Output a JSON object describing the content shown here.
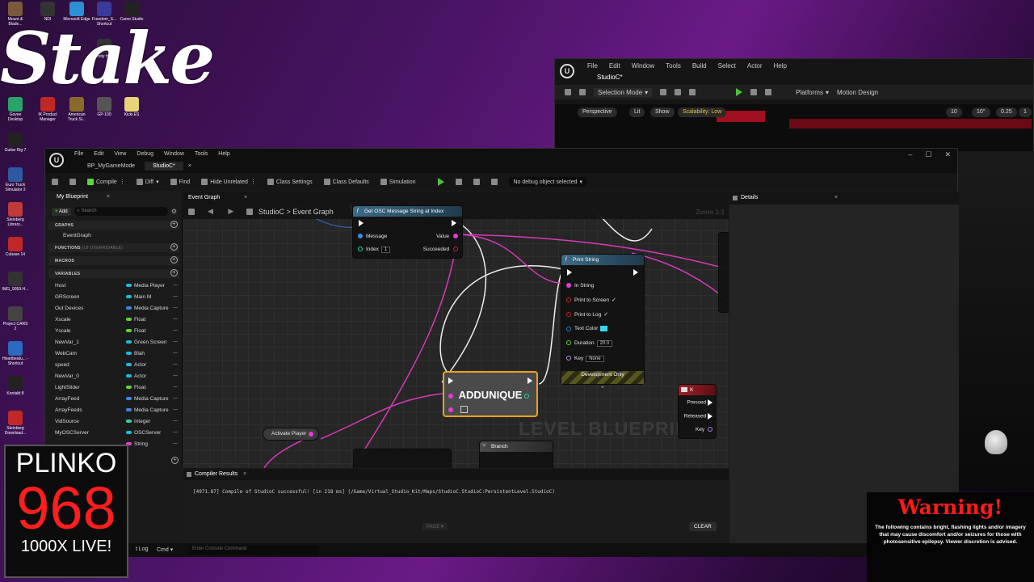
{
  "desktop": {
    "icons": [
      {
        "label": "Mount & Blade...",
        "color": "#7a5a3a"
      },
      {
        "label": "NDI",
        "color": "#333333"
      },
      {
        "label": "Microsoft Edge",
        "color": "#2d8fd6"
      },
      {
        "label": "Freedom_S... Shortcut",
        "color": "#3a3a9a"
      },
      {
        "label": "Camo Studio",
        "color": "#222222"
      },
      {
        "label": "Unity Hub",
        "color": "#333333"
      },
      {
        "label": "Govee Desktop",
        "color": "#2aa36a"
      },
      {
        "label": "IK Product Manager",
        "color": "#c02828"
      },
      {
        "label": "American Truck Si...",
        "color": "#8a6a2a"
      },
      {
        "label": "GP-100",
        "color": "#555555"
      },
      {
        "label": "Kicki.ES",
        "color": "#e8d27a"
      },
      {
        "label": "Guitar Rig 7",
        "color": "#222222"
      },
      {
        "label": "Euro Truck Simulator 2",
        "color": "#2d5aa0"
      },
      {
        "label": "Steinberg Library...",
        "color": "#c03a3a"
      },
      {
        "label": "Cubase 14",
        "color": "#c02828"
      },
      {
        "label": "IMG_9059.H...",
        "color": "#333333"
      },
      {
        "label": "Project CARS 2",
        "color": "#444444"
      },
      {
        "label": "Heartbeatu... - Shortcut",
        "color": "#2a6ac0"
      },
      {
        "label": "Kontakt 8",
        "color": "#222222"
      },
      {
        "label": "Steinberg Download...",
        "color": "#c02828"
      }
    ]
  },
  "overlays": {
    "stake_logo": "Stake",
    "plinko": {
      "title": "PLINKO",
      "number": "968",
      "subtitle": "1000X LIVE!"
    },
    "warning": {
      "title": "Warning!",
      "text": "The following contains bright, flashing lights and/or imagery that may cause discomfort and/or seizures for those with photosensitive epilepsy. Viewer discretion is advised."
    }
  },
  "back_window": {
    "menu": [
      "File",
      "Edit",
      "Window",
      "Tools",
      "Build",
      "Select",
      "Actor",
      "Help"
    ],
    "tab": "StudioC*",
    "toolbar": {
      "selection_mode": "Selection Mode",
      "platforms": "Platforms",
      "motion_design": "Motion Design"
    },
    "viewport": {
      "perspective": "Perspective",
      "lit": "Lit",
      "show": "Show",
      "scalability": "Scalability: Low",
      "grid": "10",
      "angle": "10°",
      "scale": "0.25",
      "cam": "1"
    }
  },
  "main_window": {
    "menu": [
      "File",
      "Edit",
      "View",
      "Debug",
      "Window",
      "Tools",
      "Help"
    ],
    "tabs": [
      "BP_MyGameMode",
      "StudioC*"
    ],
    "toolbar": {
      "compile": "Compile",
      "diff": "Diff",
      "find": "Find",
      "hide_unrelated": "Hide Unrelated",
      "class_settings": "Class Settings",
      "class_defaults": "Class Defaults",
      "simulation": "Simulation",
      "debug_object": "No debug object selected"
    },
    "my_blueprint": {
      "tab": "My Blueprint",
      "add": "Add",
      "search_placeholder": "Search",
      "sections": {
        "graphs": "GRAPHS",
        "event_graph": "EventGraph",
        "functions": "FUNCTIONS",
        "functions_count": "(19 OVERRIDABLE)",
        "macros": "MACROS",
        "variables": "VARIABLES"
      },
      "variables": [
        {
          "name": "Host",
          "type": "Media Player",
          "color": "#1fb8e0"
        },
        {
          "name": "GRScreen",
          "type": "Main M",
          "color": "#1fb8e0"
        },
        {
          "name": "Out Devices",
          "type": "Media Capture",
          "color": "#3a8ae0"
        },
        {
          "name": "Xscale",
          "type": "Float",
          "color": "#5fd43a"
        },
        {
          "name": "Yscale",
          "type": "Float",
          "color": "#5fd43a"
        },
        {
          "name": "NewVar_1",
          "type": "Green Screen",
          "color": "#1fb8e0"
        },
        {
          "name": "WebCam",
          "type": "Blah",
          "color": "#1fb8e0"
        },
        {
          "name": "speed",
          "type": "Actor",
          "color": "#1fb8e0"
        },
        {
          "name": "NewVar_0",
          "type": "Actor",
          "color": "#1fb8e0"
        },
        {
          "name": "LightSlider",
          "type": "Float",
          "color": "#5fd43a"
        },
        {
          "name": "ArrayFeed",
          "type": "Media Capture",
          "color": "#3a8ae0"
        },
        {
          "name": "ArrayFeeds",
          "type": "Media Capture",
          "color": "#3a8ae0"
        },
        {
          "name": "VidSource",
          "type": "Integer",
          "color": "#2ad4a8"
        },
        {
          "name": "MyOSCServer",
          "type": "OSCServer",
          "color": "#1fb8e0"
        },
        {
          "name": "",
          "type": "String",
          "color": "#e23ed0"
        }
      ]
    },
    "graph": {
      "tab": "Event Graph",
      "breadcrumb": "StudioC > Event Graph",
      "zoom": "Zoom 1:1",
      "watermark": "LEVEL BLUEPRINT",
      "nodes": {
        "get_osc": {
          "title": "Get OSC Message String at Index",
          "message": "Message",
          "index": "Index",
          "index_value": "1",
          "value": "Value",
          "succeeded": "Succeeded"
        },
        "print_string": {
          "title": "Print String",
          "in_string": "In String",
          "print_to_screen": "Print to Screen",
          "print_to_log": "Print to Log",
          "text_color": "Text Color",
          "duration": "Duration",
          "duration_value": "20.0",
          "key": "Key",
          "key_value": "None",
          "dev_only": "Development Only"
        },
        "addunique": {
          "label": "ADDUNIQUE"
        },
        "k_event": {
          "title": "K",
          "pressed": "Pressed",
          "released": "Released",
          "key": "Key"
        },
        "activate_player": {
          "label": "Activate Player"
        },
        "branch": {
          "label": "Branch"
        }
      }
    },
    "details": {
      "tab": "Details"
    },
    "compiler_results": {
      "tab": "Compiler Results",
      "line": "[4971.87] Compile of StudioC successful! [in 218 ms] (/Game/Virtual_Studio_Kit/Maps/StudioC.StudioC:PersistentLevel.StudioC)",
      "page": "PAGE",
      "clear": "CLEAR"
    },
    "status_bar": {
      "output_log": "t Log",
      "cmd": "Cmd",
      "console_placeholder": "Enter Console Command"
    }
  }
}
